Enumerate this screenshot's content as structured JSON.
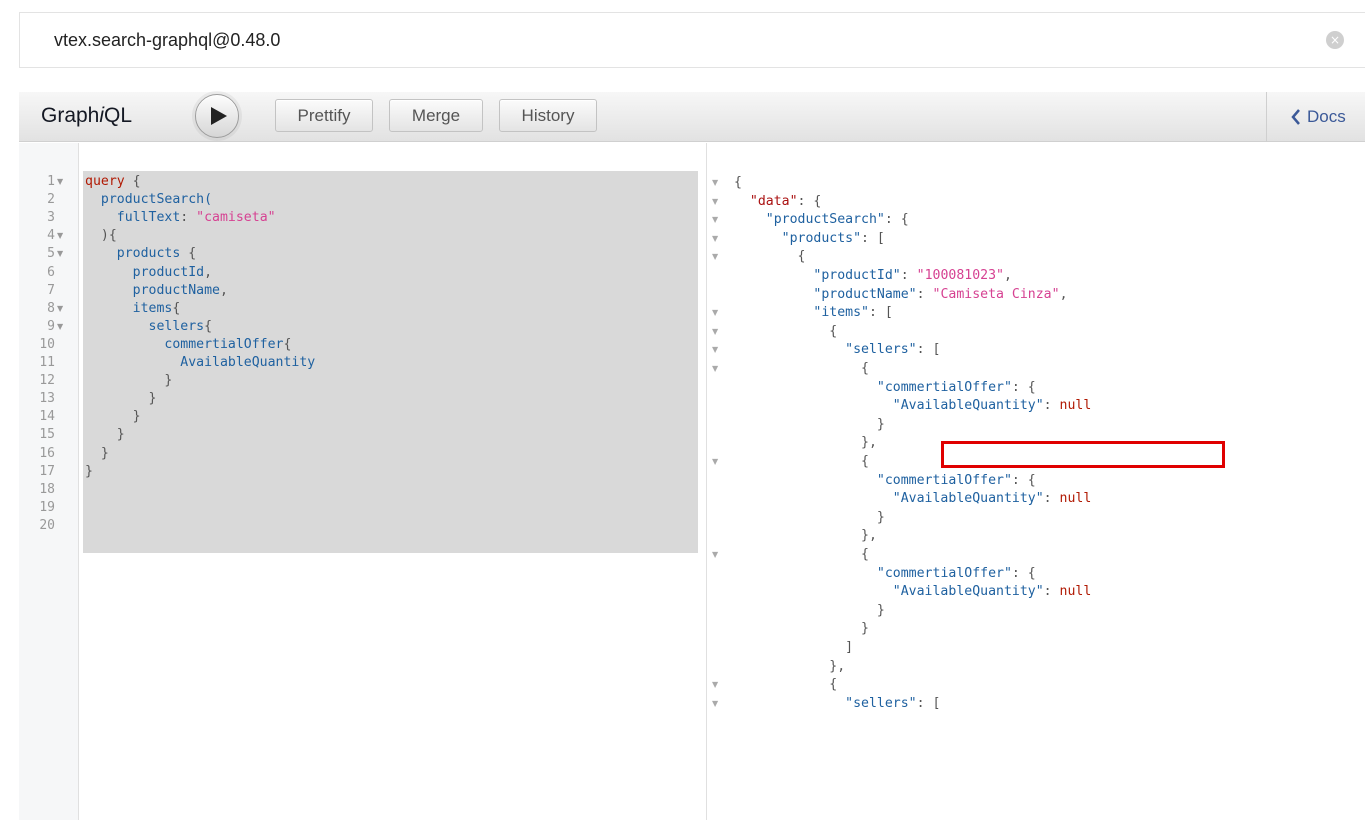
{
  "search": {
    "value": "vtex.search-graphql@0.48.0",
    "clear_icon": "close-circle-icon"
  },
  "toolbar": {
    "title_prefix": "Graph",
    "title_italic": "i",
    "title_suffix": "QL",
    "run_icon": "play-icon",
    "prettify_label": "Prettify",
    "merge_label": "Merge",
    "history_label": "History",
    "docs_label": "Docs",
    "docs_icon": "chevron-left-icon"
  },
  "editor": {
    "lines": [
      {
        "no": "1",
        "fold": true,
        "parts": [
          [
            "kw",
            "query"
          ],
          [
            "pn",
            " {"
          ]
        ]
      },
      {
        "no": "2",
        "fold": false,
        "parts": [
          [
            "fn",
            "  productSearch("
          ]
        ]
      },
      {
        "no": "3",
        "fold": false,
        "parts": [
          [
            "fn",
            "    fullText"
          ],
          [
            "pn",
            ": "
          ],
          [
            "str",
            "\"camiseta\""
          ]
        ]
      },
      {
        "no": "4",
        "fold": true,
        "parts": [
          [
            "pn",
            "  ){"
          ]
        ]
      },
      {
        "no": "5",
        "fold": true,
        "parts": [
          [
            "fn",
            "    products"
          ],
          [
            "pn",
            " {"
          ]
        ]
      },
      {
        "no": "6",
        "fold": false,
        "parts": [
          [
            "fn",
            "      productId"
          ],
          [
            "pn",
            ","
          ]
        ]
      },
      {
        "no": "7",
        "fold": false,
        "parts": [
          [
            "fn",
            "      productName"
          ],
          [
            "pn",
            ","
          ]
        ]
      },
      {
        "no": "8",
        "fold": true,
        "parts": [
          [
            "fn",
            "      items"
          ],
          [
            "pn",
            "{"
          ]
        ]
      },
      {
        "no": "9",
        "fold": true,
        "parts": [
          [
            "fn",
            "        sellers"
          ],
          [
            "pn",
            "{"
          ]
        ]
      },
      {
        "no": "10",
        "fold": false,
        "parts": [
          [
            "fn",
            "          commertialOffer"
          ],
          [
            "pn",
            "{"
          ]
        ]
      },
      {
        "no": "11",
        "fold": false,
        "parts": [
          [
            "fn",
            "            AvailableQuantity"
          ]
        ]
      },
      {
        "no": "12",
        "fold": false,
        "parts": [
          [
            "pn",
            "          }"
          ]
        ]
      },
      {
        "no": "13",
        "fold": false,
        "parts": [
          [
            "pn",
            "        }"
          ]
        ]
      },
      {
        "no": "14",
        "fold": false,
        "parts": [
          [
            "pn",
            "      }"
          ]
        ]
      },
      {
        "no": "15",
        "fold": false,
        "parts": [
          [
            "pn",
            "    }"
          ]
        ]
      },
      {
        "no": "16",
        "fold": false,
        "parts": [
          [
            "pn",
            "  }"
          ]
        ]
      },
      {
        "no": "17",
        "fold": false,
        "parts": [
          [
            "pn",
            "}"
          ]
        ]
      },
      {
        "no": "18",
        "fold": false,
        "parts": []
      },
      {
        "no": "19",
        "fold": false,
        "parts": []
      },
      {
        "no": "20",
        "fold": false,
        "parts": []
      }
    ]
  },
  "result": {
    "lines": [
      {
        "fold": true,
        "parts": [
          [
            "pn",
            "{"
          ]
        ]
      },
      {
        "fold": true,
        "parts": [
          [
            "pn",
            "  "
          ],
          [
            "key",
            "\"data\""
          ],
          [
            "pn",
            ": {"
          ]
        ]
      },
      {
        "fold": true,
        "parts": [
          [
            "pn",
            "    "
          ],
          [
            "key2",
            "\"productSearch\""
          ],
          [
            "pn",
            ": {"
          ]
        ]
      },
      {
        "fold": true,
        "parts": [
          [
            "pn",
            "      "
          ],
          [
            "key2",
            "\"products\""
          ],
          [
            "pn",
            ": ["
          ]
        ]
      },
      {
        "fold": true,
        "parts": [
          [
            "pn",
            "        {"
          ]
        ]
      },
      {
        "fold": false,
        "parts": [
          [
            "pn",
            "          "
          ],
          [
            "key2",
            "\"productId\""
          ],
          [
            "pn",
            ": "
          ],
          [
            "sv",
            "\"100081023\""
          ],
          [
            "pn",
            ","
          ]
        ]
      },
      {
        "fold": false,
        "parts": [
          [
            "pn",
            "          "
          ],
          [
            "key2",
            "\"productName\""
          ],
          [
            "pn",
            ": "
          ],
          [
            "sv",
            "\"Camiseta Cinza\""
          ],
          [
            "pn",
            ","
          ]
        ]
      },
      {
        "fold": true,
        "parts": [
          [
            "pn",
            "          "
          ],
          [
            "key2",
            "\"items\""
          ],
          [
            "pn",
            ": ["
          ]
        ]
      },
      {
        "fold": true,
        "parts": [
          [
            "pn",
            "            {"
          ]
        ]
      },
      {
        "fold": true,
        "parts": [
          [
            "pn",
            "              "
          ],
          [
            "key2",
            "\"sellers\""
          ],
          [
            "pn",
            ": ["
          ]
        ]
      },
      {
        "fold": true,
        "parts": [
          [
            "pn",
            "                {"
          ]
        ]
      },
      {
        "fold": false,
        "parts": [
          [
            "pn",
            "                  "
          ],
          [
            "key2",
            "\"commertialOffer\""
          ],
          [
            "pn",
            ": {"
          ]
        ]
      },
      {
        "fold": false,
        "parts": [
          [
            "pn",
            "                    "
          ],
          [
            "key2",
            "\"AvailableQuantity\""
          ],
          [
            "pn",
            ": "
          ],
          [
            "nul",
            "null"
          ]
        ]
      },
      {
        "fold": false,
        "parts": [
          [
            "pn",
            "                  }"
          ]
        ]
      },
      {
        "fold": false,
        "parts": [
          [
            "pn",
            "                },"
          ]
        ]
      },
      {
        "fold": true,
        "parts": [
          [
            "pn",
            "                {"
          ]
        ]
      },
      {
        "fold": false,
        "parts": [
          [
            "pn",
            "                  "
          ],
          [
            "key2",
            "\"commertialOffer\""
          ],
          [
            "pn",
            ": {"
          ]
        ]
      },
      {
        "fold": false,
        "parts": [
          [
            "pn",
            "                    "
          ],
          [
            "key2",
            "\"AvailableQuantity\""
          ],
          [
            "pn",
            ": "
          ],
          [
            "nul",
            "null"
          ]
        ]
      },
      {
        "fold": false,
        "parts": [
          [
            "pn",
            "                  }"
          ]
        ]
      },
      {
        "fold": false,
        "parts": [
          [
            "pn",
            "                },"
          ]
        ]
      },
      {
        "fold": true,
        "parts": [
          [
            "pn",
            "                {"
          ]
        ]
      },
      {
        "fold": false,
        "parts": [
          [
            "pn",
            "                  "
          ],
          [
            "key2",
            "\"commertialOffer\""
          ],
          [
            "pn",
            ": {"
          ]
        ]
      },
      {
        "fold": false,
        "parts": [
          [
            "pn",
            "                    "
          ],
          [
            "key2",
            "\"AvailableQuantity\""
          ],
          [
            "pn",
            ": "
          ],
          [
            "nul",
            "null"
          ]
        ]
      },
      {
        "fold": false,
        "parts": [
          [
            "pn",
            "                  }"
          ]
        ]
      },
      {
        "fold": false,
        "parts": [
          [
            "pn",
            "                }"
          ]
        ]
      },
      {
        "fold": false,
        "parts": [
          [
            "pn",
            "              ]"
          ]
        ]
      },
      {
        "fold": false,
        "parts": [
          [
            "pn",
            "            },"
          ]
        ]
      },
      {
        "fold": true,
        "parts": [
          [
            "pn",
            "            {"
          ]
        ]
      },
      {
        "fold": true,
        "parts": [
          [
            "pn",
            "              "
          ],
          [
            "key2",
            "\"sellers\""
          ],
          [
            "pn",
            ": ["
          ]
        ]
      }
    ]
  },
  "colors": {
    "highlight": "#e00000",
    "keyword": "#b11a04",
    "string": "#d64292",
    "property": "#1f61a0"
  }
}
